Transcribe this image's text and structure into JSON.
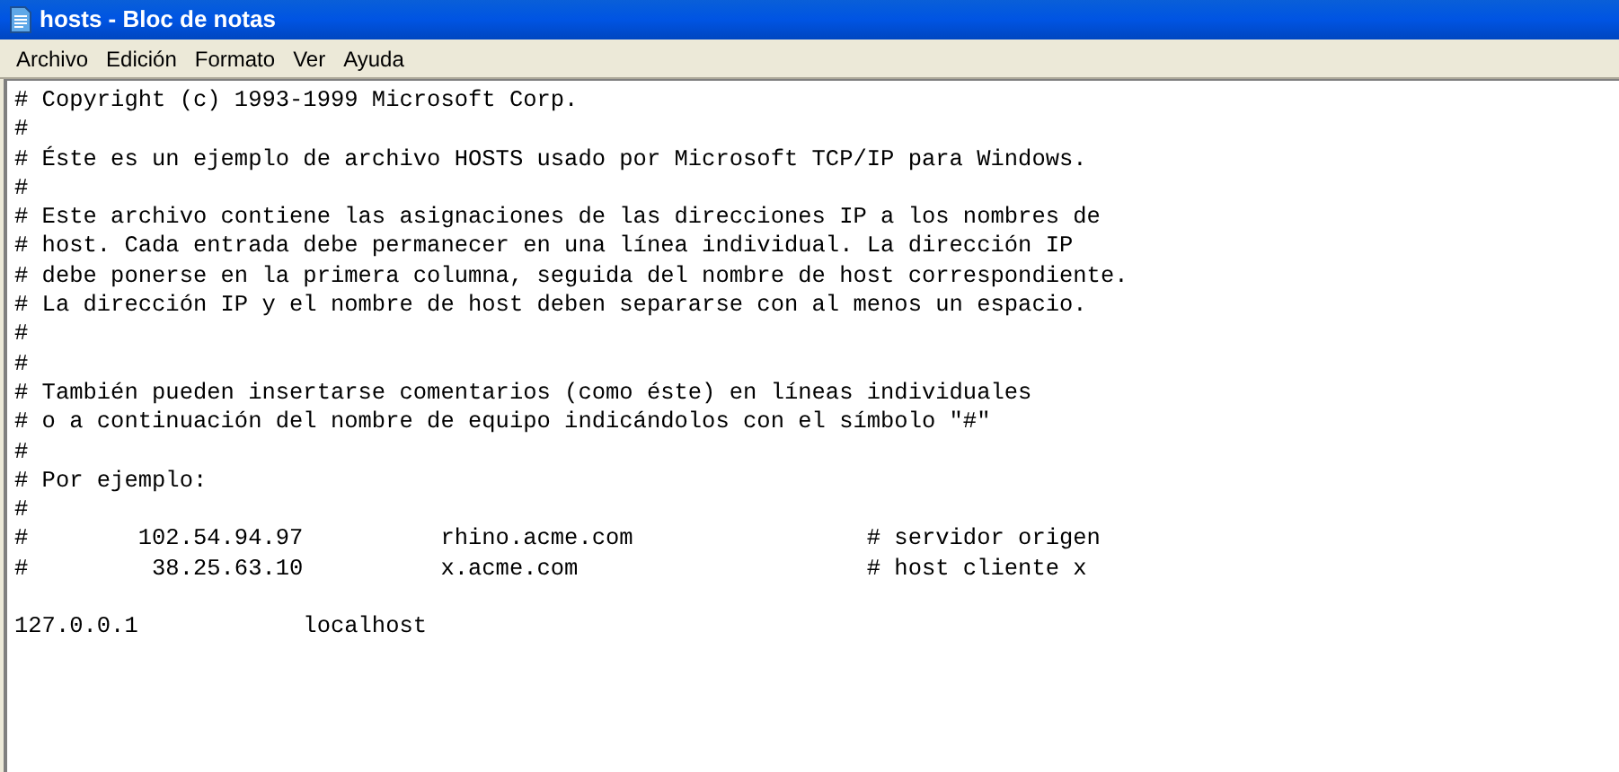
{
  "window": {
    "title": "hosts - Bloc de notas"
  },
  "menu": [
    "Archivo",
    "Edición",
    "Formato",
    "Ver",
    "Ayuda"
  ],
  "lines": [
    {
      "text": "# Copyright (c) 1993-1999 Microsoft Corp."
    },
    {
      "text": "#"
    },
    {
      "text": "# Éste es un ejemplo de archivo HOSTS usado por Microsoft TCP/IP para Windows."
    },
    {
      "text": "#"
    },
    {
      "text": "# Este archivo contiene las asignaciones de las direcciones IP a los nombres de"
    },
    {
      "text": "# host. Cada entrada debe permanecer en una línea individual. La dirección IP"
    },
    {
      "text": "# debe ponerse en la primera columna, seguida del nombre de host correspondiente."
    },
    {
      "text": "# La dirección IP y el nombre de host deben separarse con al menos un espacio."
    },
    {
      "text": "#"
    },
    {
      "text": "#"
    },
    {
      "text": "# También pueden insertarse comentarios (como éste) en líneas individuales"
    },
    {
      "text": "# o a continuación del nombre de equipo indicándolos con el símbolo \"#\""
    },
    {
      "text": "#"
    },
    {
      "text": "# Por ejemplo:"
    },
    {
      "text": "#"
    },
    {
      "text": "#        102.54.94.97          rhino.acme.com                 # servidor origen"
    },
    {
      "text": "#         38.25.63.10          x.acme.com                     # host cliente x"
    },
    {
      "text": "127.0.0.1            localhost",
      "blank_line_before": true
    }
  ]
}
